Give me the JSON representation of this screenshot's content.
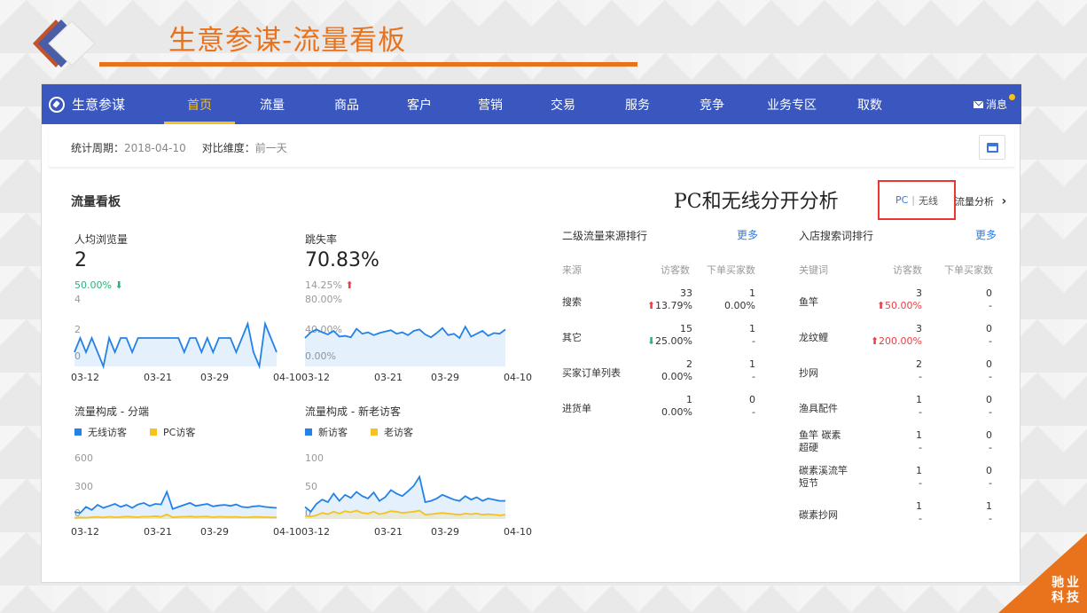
{
  "slide": {
    "title": "生意参谋-流量看板",
    "accent": "#e9731d"
  },
  "nav": {
    "brand": "生意参谋",
    "items": [
      "首页",
      "流量",
      "商品",
      "客户",
      "营销",
      "交易",
      "服务",
      "竞争",
      "业务专区",
      "取数"
    ],
    "active": "首页",
    "dotted": [
      "流量",
      "客户",
      "营销"
    ],
    "message": "消息",
    "color": "#3a57c0"
  },
  "period": {
    "label1": "统计周期：",
    "value1": "2018-04-10",
    "label2": "对比维度：",
    "value2": "前一天"
  },
  "board": {
    "title": "流量看板",
    "annotation": "PC和无线分开分析",
    "switch_pc": "PC",
    "switch_sep": "|",
    "switch_wireless": "无线",
    "analysis_link": "流量分析",
    "analysis_arrow": "›"
  },
  "metrics": {
    "pv": {
      "label": "人均浏览量",
      "value": "2",
      "change": "50.00%",
      "dir": "down"
    },
    "bounce": {
      "label": "跳失率",
      "value": "70.83%",
      "change": "14.25%",
      "dir": "up"
    }
  },
  "chart_data": [
    {
      "type": "area",
      "title": "人均浏览量",
      "x_ticks": [
        "03-12",
        "03-21",
        "03-29",
        "04-10"
      ],
      "y_ticks": [
        "4",
        "2",
        "0"
      ],
      "ylim": [
        0,
        4
      ],
      "values": [
        1,
        2,
        1,
        2,
        1,
        0,
        2,
        1,
        2,
        2,
        1,
        2,
        2,
        2,
        2,
        2,
        2,
        2,
        2,
        1,
        2,
        2,
        1,
        2,
        1,
        2,
        2,
        2,
        1,
        2,
        3,
        1,
        0,
        3,
        2,
        1
      ]
    },
    {
      "type": "area",
      "title": "跳失率",
      "x_ticks": [
        "03-12",
        "03-21",
        "03-29",
        "04-10"
      ],
      "y_ticks": [
        "80.00%",
        "40.00%",
        "0.00%"
      ],
      "ylim": [
        0,
        80
      ],
      "values": [
        40,
        48,
        52,
        48,
        45,
        50,
        42,
        43,
        41,
        53,
        46,
        48,
        44,
        47,
        49,
        51,
        46,
        48,
        44,
        50,
        52,
        45,
        41,
        47,
        54,
        44,
        46,
        40,
        56,
        42,
        46,
        50,
        43,
        47,
        46,
        52
      ]
    },
    {
      "type": "line",
      "title": "流量构成 - 分端",
      "x_ticks": [
        "03-12",
        "03-21",
        "03-29",
        "04-10"
      ],
      "y_ticks": [
        "600",
        "300",
        "0"
      ],
      "ylim": [
        0,
        600
      ],
      "legend": [
        "无线访客",
        "PC访客"
      ],
      "series": [
        {
          "name": "无线访客",
          "color": "#2382e8",
          "values": [
            70,
            60,
            120,
            90,
            140,
            110,
            130,
            150,
            120,
            140,
            110,
            145,
            160,
            130,
            150,
            145,
            270,
            100,
            120,
            140,
            160,
            130,
            140,
            150,
            125,
            135,
            140,
            130,
            145,
            120,
            115,
            125,
            130,
            120,
            115,
            110
          ]
        },
        {
          "name": "PC访客",
          "color": "#f6c21b",
          "values": [
            10,
            15,
            12,
            18,
            20,
            14,
            22,
            17,
            19,
            24,
            20,
            18,
            23,
            22,
            28,
            21,
            45,
            16,
            20,
            22,
            25,
            20,
            23,
            24,
            18,
            22,
            20,
            19,
            21,
            18,
            17,
            20,
            19,
            18,
            16,
            15
          ]
        }
      ]
    },
    {
      "type": "line",
      "title": "流量构成 - 新老访客",
      "x_ticks": [
        "03-12",
        "03-21",
        "03-29",
        "04-10"
      ],
      "y_ticks": [
        "100",
        "50",
        "0"
      ],
      "ylim": [
        0,
        100
      ],
      "legend": [
        "新访客",
        "老访客"
      ],
      "series": [
        {
          "name": "新访客",
          "color": "#2382e8",
          "values": [
            20,
            12,
            25,
            32,
            28,
            42,
            30,
            40,
            35,
            45,
            38,
            34,
            44,
            30,
            36,
            48,
            42,
            38,
            46,
            55,
            70,
            28,
            30,
            34,
            40,
            36,
            32,
            30,
            38,
            32,
            36,
            30,
            34,
            32,
            30,
            30
          ]
        },
        {
          "name": "老访客",
          "color": "#f6c21b",
          "values": [
            5,
            4,
            6,
            10,
            8,
            12,
            9,
            13,
            11,
            14,
            10,
            9,
            12,
            8,
            10,
            13,
            12,
            10,
            11,
            12,
            14,
            7,
            8,
            9,
            10,
            9,
            8,
            7,
            9,
            8,
            9,
            7,
            8,
            7,
            6,
            7
          ]
        }
      ]
    }
  ],
  "sources": {
    "title": "二级流量来源排行",
    "more": "更多",
    "headers": [
      "来源",
      "访客数",
      "下单买家数"
    ],
    "rows": [
      {
        "name": "搜索",
        "visitors": "33",
        "visitors_change": "13.79%",
        "dir": "up",
        "buyers": "1",
        "buyers_change": "0.00%"
      },
      {
        "name": "其它",
        "visitors": "15",
        "visitors_change": "25.00%",
        "dir": "down",
        "buyers": "1",
        "buyers_change": "-"
      },
      {
        "name": "买家订单列表",
        "visitors": "2",
        "visitors_change": "0.00%",
        "dir": "",
        "buyers": "1",
        "buyers_change": "-"
      },
      {
        "name": "进货单",
        "visitors": "1",
        "visitors_change": "0.00%",
        "dir": "",
        "buyers": "0",
        "buyers_change": "-"
      }
    ]
  },
  "keywords": {
    "title": "入店搜索词排行",
    "more": "更多",
    "headers": [
      "关键词",
      "访客数",
      "下单买家数"
    ],
    "rows": [
      {
        "name": "鱼竿",
        "visitors": "3",
        "visitors_change": "50.00%",
        "dir": "up",
        "buyers": "0",
        "buyers_change": "-"
      },
      {
        "name": "龙纹鲤",
        "visitors": "3",
        "visitors_change": "200.00%",
        "dir": "up",
        "buyers": "0",
        "buyers_change": "-"
      },
      {
        "name": "抄网",
        "visitors": "2",
        "visitors_change": "-",
        "dir": "",
        "buyers": "0",
        "buyers_change": "-"
      },
      {
        "name": "渔具配件",
        "visitors": "1",
        "visitors_change": "-",
        "dir": "",
        "buyers": "0",
        "buyers_change": "-"
      },
      {
        "name": "鱼竿 碳素\n超硬",
        "visitors": "1",
        "visitors_change": "-",
        "dir": "",
        "buyers": "0",
        "buyers_change": "-"
      },
      {
        "name": "碳素溪流竿\n短节",
        "visitors": "1",
        "visitors_change": "-",
        "dir": "",
        "buyers": "0",
        "buyers_change": "-"
      },
      {
        "name": "碳素抄网",
        "visitors": "1",
        "visitors_change": "-",
        "dir": "",
        "buyers": "1",
        "buyers_change": "-"
      }
    ]
  },
  "corner": {
    "line1": "驰业",
    "line2": "科技"
  }
}
